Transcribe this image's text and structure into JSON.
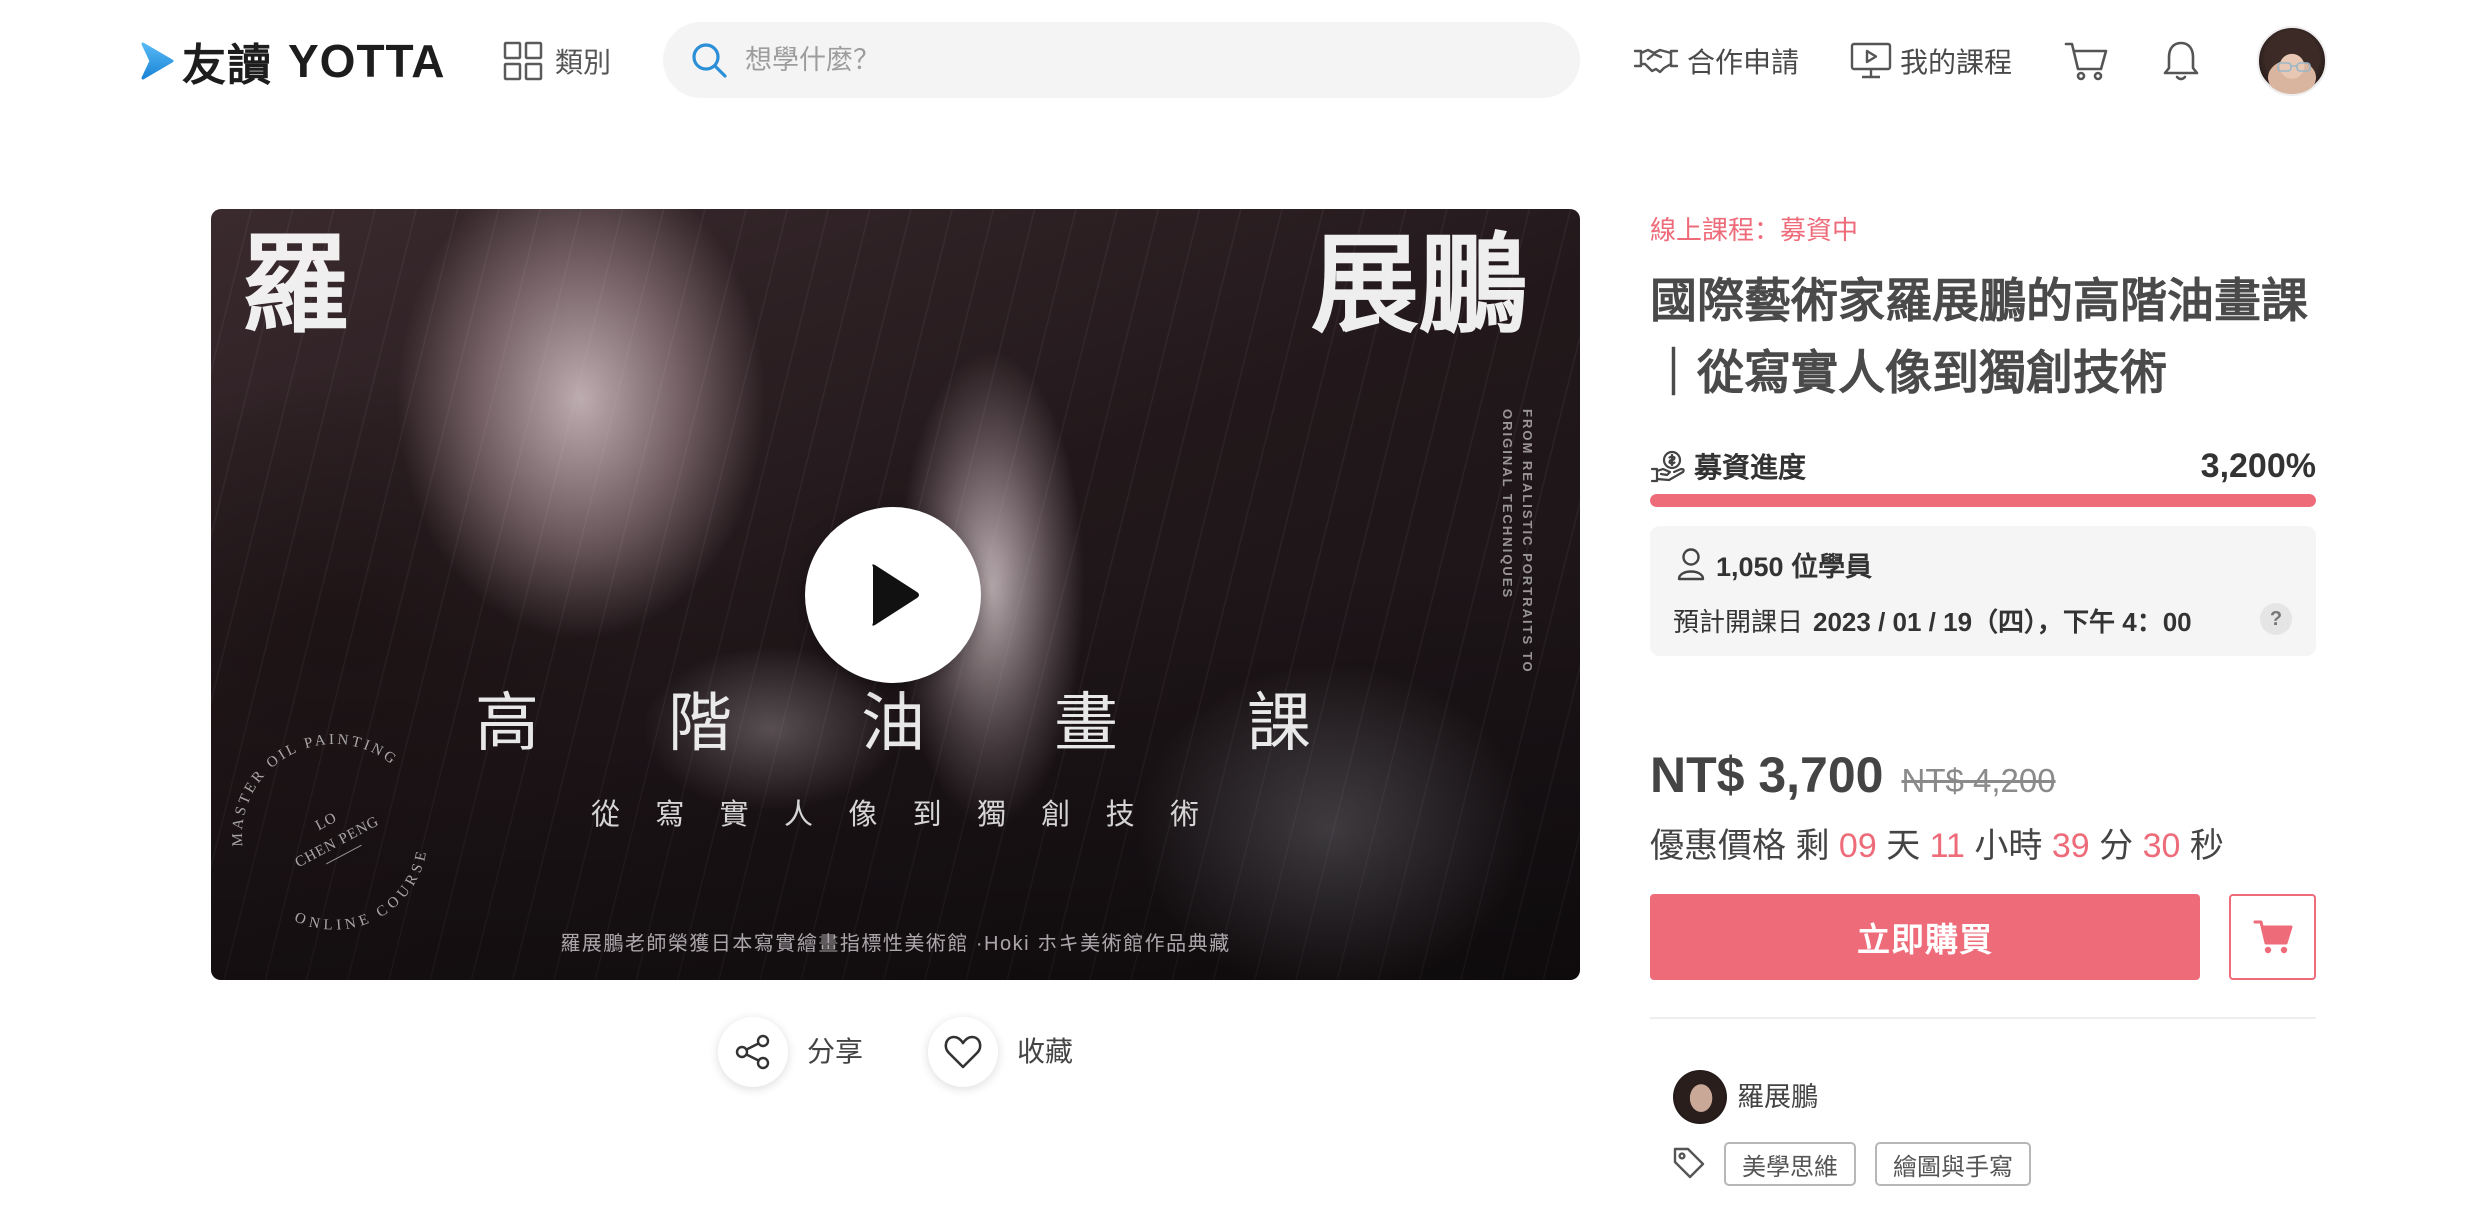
{
  "header": {
    "logo_cn": "友讀",
    "logo_en": "YOTTA",
    "category_label": "類別",
    "search_placeholder": "想學什麼？",
    "partner_label": "合作申請",
    "my_courses_label": "我的課程",
    "icons": [
      "yotta-logo-icon",
      "grid-icon",
      "search-icon",
      "handshake-icon",
      "screen-play-icon",
      "cart-icon",
      "bell-icon"
    ]
  },
  "video": {
    "title_left": "羅",
    "title_right": "展鵬",
    "main_title_chars": [
      "高",
      "階",
      "油",
      "畫",
      "課"
    ],
    "subtitle_chars": [
      "從",
      "寫",
      "實",
      "人",
      "像",
      "到",
      "獨",
      "創",
      "技",
      "術"
    ],
    "side_text_lines": [
      "FROM REALISTIC PORTRAITS TO",
      "ORIGINAL TECHNIQUES"
    ],
    "seal": {
      "top_arc": "MASTER OIL PAINTING",
      "name_line1": "LO",
      "name_line2": "CHEN PENG",
      "bottom_arc": "ONLINE COURSE"
    },
    "caption": "羅展鵬老師榮獲日本寫實繪畫指標性美術館 ·Hoki ホキ美術館作品典藏",
    "play_icon": "play-icon"
  },
  "actions": {
    "share_label": "分享",
    "favorite_label": "收藏"
  },
  "course": {
    "status": "線上課程：募資中",
    "title": "國際藝術家羅展鵬的高階油畫課｜從寫實人像到獨創技術",
    "funding_label": "募資進度",
    "funding_percent_text": "3,200%",
    "funding_bar_fill": 1.0,
    "students_text": "1,050 位學員",
    "start_label": "預計開課日",
    "start_value": "2023 / 01 / 19（四），下午 4：00",
    "help_mark": "?"
  },
  "pricing": {
    "price": "NT$ 3,700",
    "original_price": "NT$ 4,200",
    "countdown_label": "優惠價格 剩",
    "countdown": {
      "days": "09",
      "days_unit": "天",
      "hours": "11",
      "hours_unit": "小時",
      "minutes": "39",
      "minutes_unit": "分",
      "seconds": "30",
      "seconds_unit": "秒"
    },
    "buy_label": "立即購買"
  },
  "instructor": {
    "name": "羅展鵬"
  },
  "tags": [
    "美學思維",
    "繪圖與手寫"
  ],
  "colors": {
    "accent": "#ee6b7a",
    "brand": "#2b9be8",
    "text": "#444444"
  }
}
